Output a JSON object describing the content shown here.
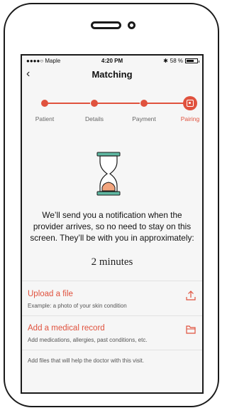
{
  "status": {
    "carrier": "●●●●○ Maple",
    "time": "4:20 PM",
    "battery": "58 %"
  },
  "nav": {
    "title": "Matching"
  },
  "steps": [
    {
      "label": "Patient"
    },
    {
      "label": "Details"
    },
    {
      "label": "Payment"
    },
    {
      "label": "Pairing"
    }
  ],
  "message": "We’ll send you a notification when the provider arrives, so no need to stay on this screen. They’ll be with you in approximately:",
  "eta": "2 minutes",
  "actions": [
    {
      "label": "Upload a file",
      "sub": "Example: a photo of your skin condition",
      "icon": "upload-icon"
    },
    {
      "label": "Add a medical record",
      "sub": "Add medications, allergies, past conditions, etc.",
      "icon": "folder-icon"
    }
  ],
  "footnote": "Add files that will help the doctor with this visit.",
  "colors": {
    "accent": "#e0523e",
    "hourglass_frame": "#5fb8a2",
    "sand": "#f3a57e"
  }
}
